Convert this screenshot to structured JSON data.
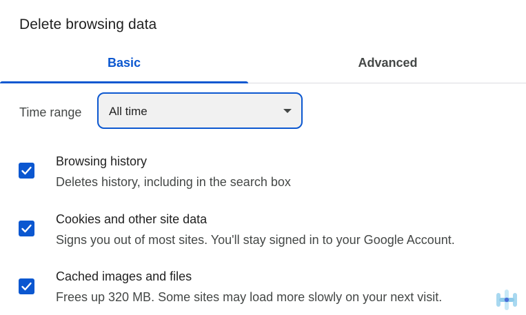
{
  "dialog": {
    "title": "Delete browsing data"
  },
  "tabs": [
    {
      "label": "Basic",
      "selected": true
    },
    {
      "label": "Advanced",
      "selected": false
    }
  ],
  "time_range": {
    "label": "Time range",
    "value": "All time"
  },
  "options": [
    {
      "title": "Browsing history",
      "description": "Deletes history, including in the search box",
      "checked": true
    },
    {
      "title": "Cookies and other site data",
      "description": "Signs you out of most sites. You'll stay signed in to your Google Account.",
      "checked": true
    },
    {
      "title": "Cached images and files",
      "description": "Frees up 320 MB. Some sites may load more slowly on your next visit.",
      "checked": true
    }
  ],
  "colors": {
    "accent": "#0b57d0",
    "text_primary": "#1f1f1f",
    "text_secondary": "#444746",
    "select_background": "#f1f1f1",
    "divider": "#dadce0"
  },
  "icons": {
    "checkbox_check": "check-icon",
    "dropdown": "caret-down-icon",
    "watermark": "brand-watermark-icon"
  }
}
